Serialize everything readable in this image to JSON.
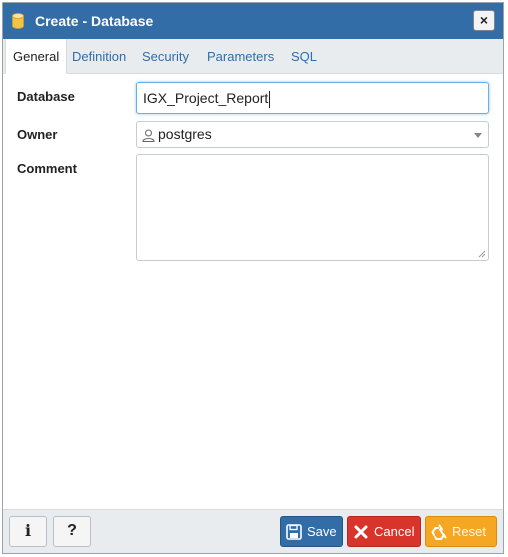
{
  "dialog": {
    "title": "Create - Database",
    "close_label": "×"
  },
  "tabs": [
    {
      "label": "General",
      "active": true
    },
    {
      "label": "Definition"
    },
    {
      "label": "Security"
    },
    {
      "label": "Parameters"
    },
    {
      "label": "SQL"
    }
  ],
  "form": {
    "database_label": "Database",
    "database_value": "IGX_Project_Report",
    "owner_label": "Owner",
    "owner_value": "postgres",
    "comment_label": "Comment",
    "comment_value": ""
  },
  "footer": {
    "info_label": "i",
    "help_label": "?",
    "save_label": "Save",
    "cancel_label": "Cancel",
    "reset_label": "Reset"
  },
  "colors": {
    "titlebar": "#326da8",
    "save": "#326da8",
    "cancel": "#d9342b",
    "reset": "#f5a623"
  }
}
